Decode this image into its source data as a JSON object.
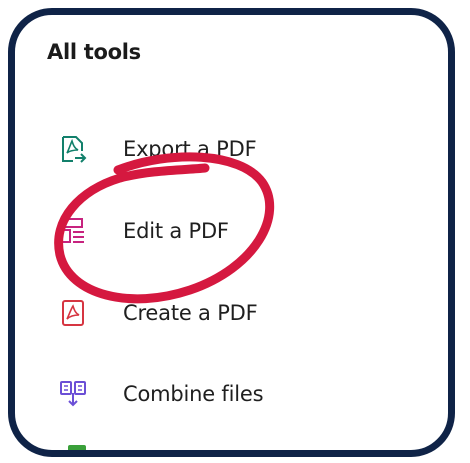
{
  "panel": {
    "title": "All tools"
  },
  "tools": [
    {
      "label": "Export a PDF",
      "icon": "export-pdf-icon",
      "color": "#12806b"
    },
    {
      "label": "Edit a PDF",
      "icon": "edit-pdf-icon",
      "color": "#c7237f"
    },
    {
      "label": "Create a PDF",
      "icon": "create-pdf-icon",
      "color": "#d63541"
    },
    {
      "label": "Combine files",
      "icon": "combine-files-icon",
      "color": "#6b4fd6"
    }
  ],
  "colors": {
    "frame_border": "#0f2347",
    "highlight_circle": "#d5183f",
    "text": "#1f1f1f"
  }
}
